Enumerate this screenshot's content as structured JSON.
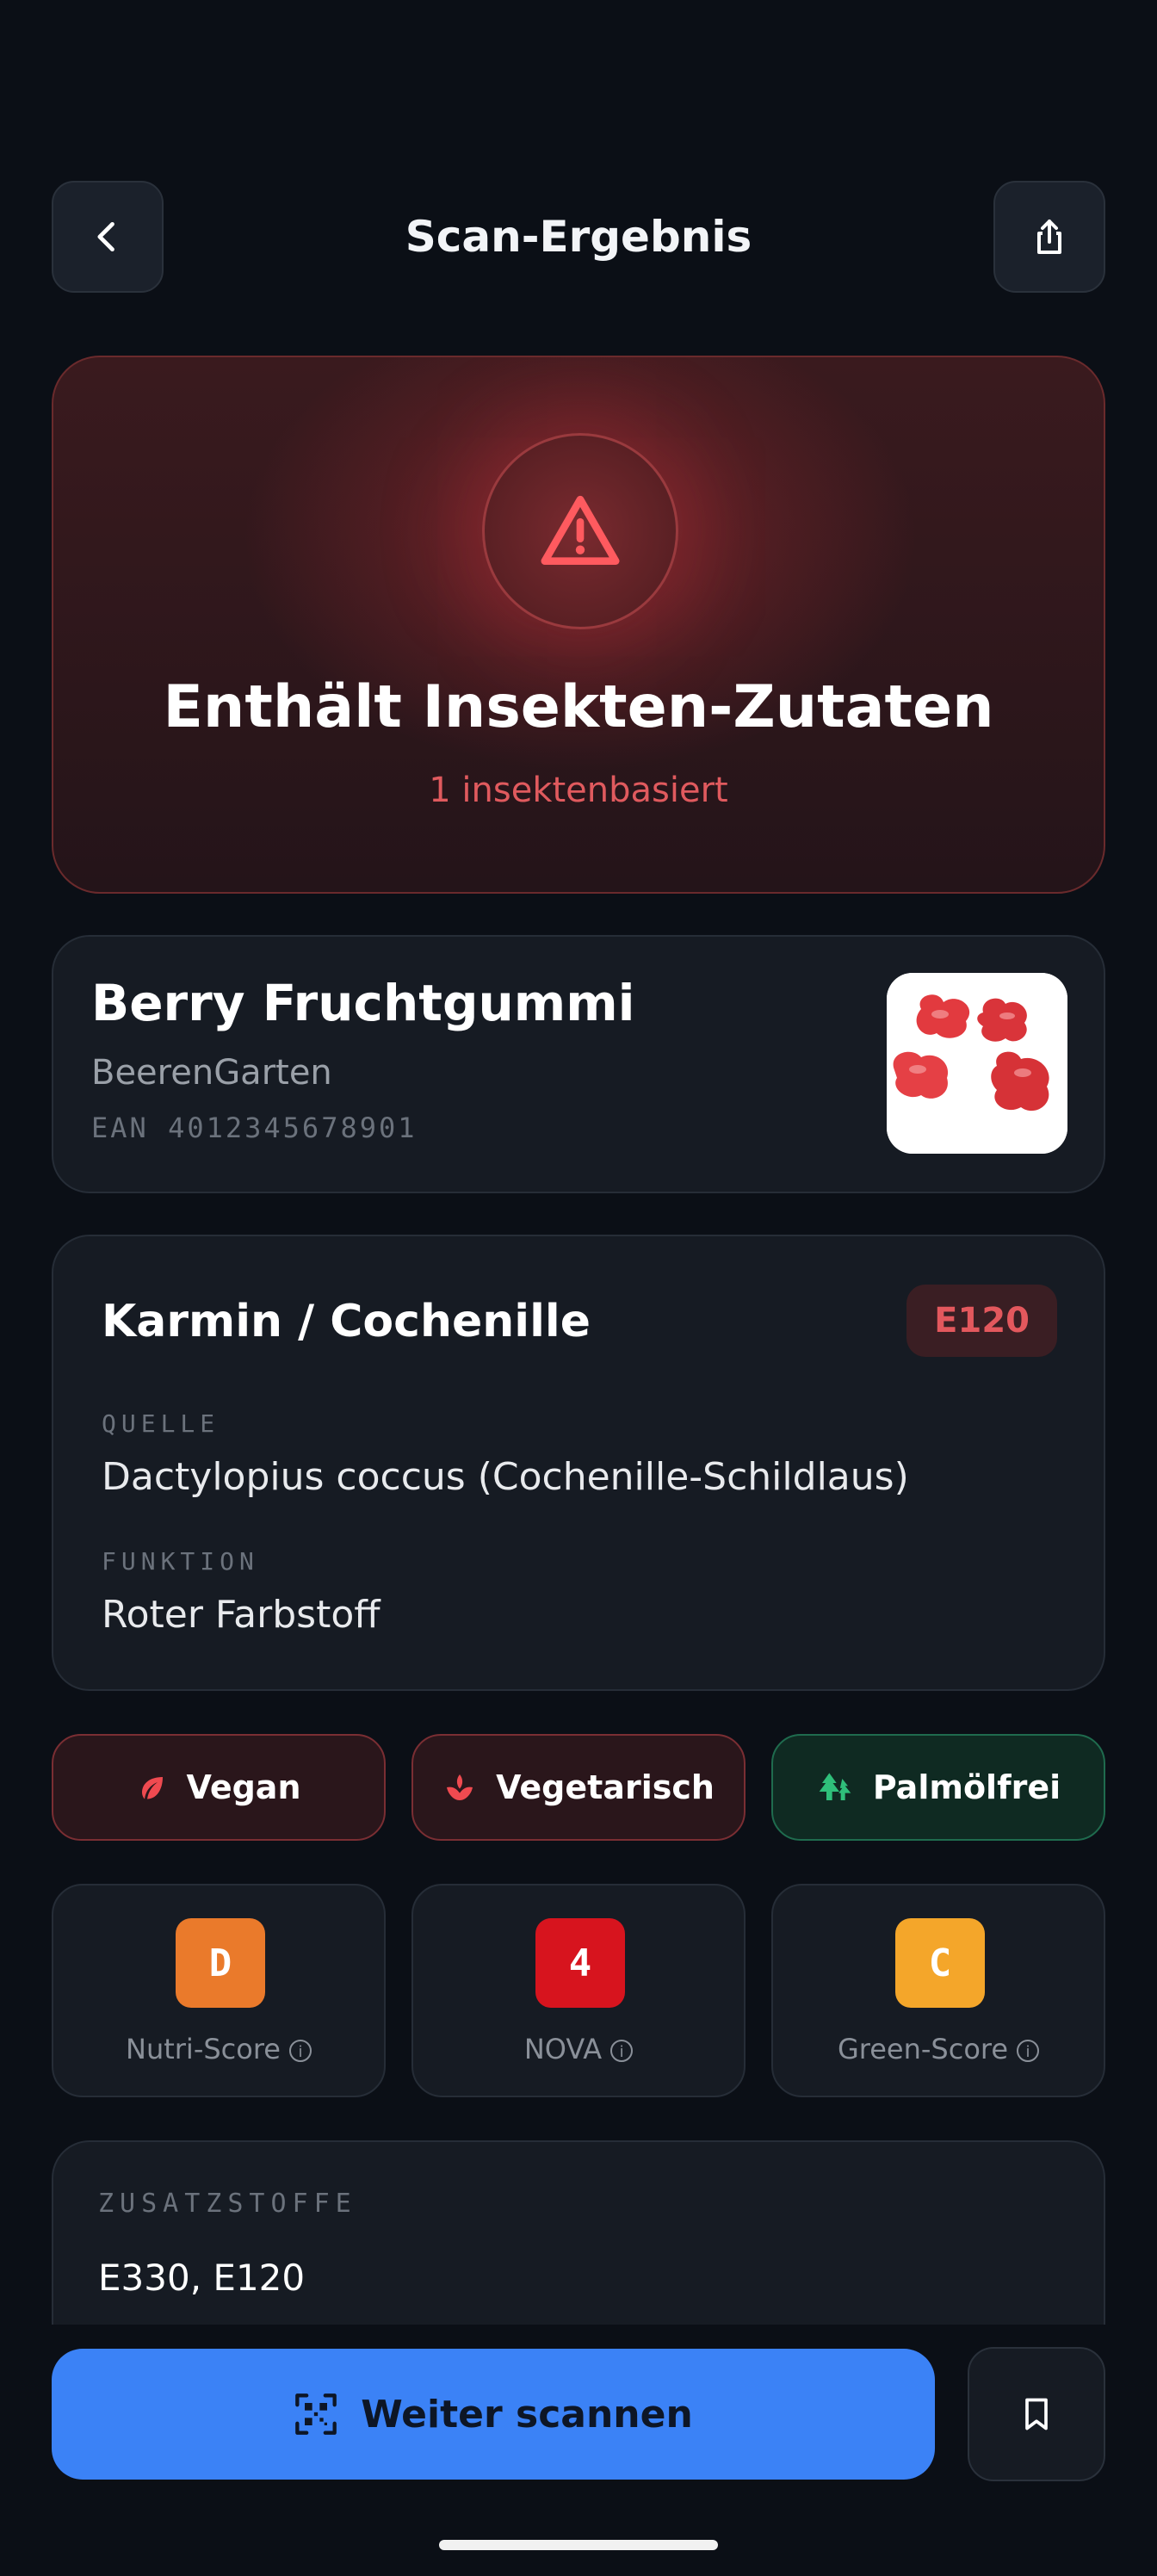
{
  "header": {
    "title": "Scan-Ergebnis",
    "back_icon": "chevron-left-icon",
    "share_icon": "share-icon"
  },
  "alert": {
    "icon": "warning-icon",
    "title": "Enthält Insekten-Zutaten",
    "subtitle": "1 insektenbasiert",
    "accent": "#e3585d"
  },
  "product": {
    "name": "Berry Fruchtgummi",
    "brand": "BeerenGarten",
    "ean": "EAN 4012345678901"
  },
  "ingredient": {
    "name": "Karmin / Cochenille",
    "code": "E120",
    "source_label": "QUELLE",
    "source_value": "Dactylopius coccus (Cochenille-Schildlaus)",
    "function_label": "FUNKTION",
    "function_value": "Roter Farbstoff"
  },
  "diet_chips": [
    {
      "label": "Vegan",
      "icon": "leaf-icon",
      "status": "fail"
    },
    {
      "label": "Vegetarisch",
      "icon": "lotus-icon",
      "status": "fail"
    },
    {
      "label": "Palmölfrei",
      "icon": "trees-icon",
      "status": "pass"
    }
  ],
  "scores": [
    {
      "letter": "D",
      "label": "Nutri-Score",
      "color": "#ea7a2b"
    },
    {
      "letter": "4",
      "label": "NOVA",
      "color": "#d7141e"
    },
    {
      "letter": "C",
      "label": "Green-Score",
      "color": "#f4a62a"
    }
  ],
  "additives": {
    "label": "ZUSATZSTOFFE",
    "value": "E330, E120"
  },
  "actions": {
    "scan_label": "Weiter scannen",
    "scan_icon": "qr-scan-icon",
    "save_icon": "bookmark-icon"
  },
  "colors": {
    "background": "#0b0f16",
    "primary": "#3b82f6",
    "danger": "#e3585d",
    "success": "#2fbf7a"
  }
}
